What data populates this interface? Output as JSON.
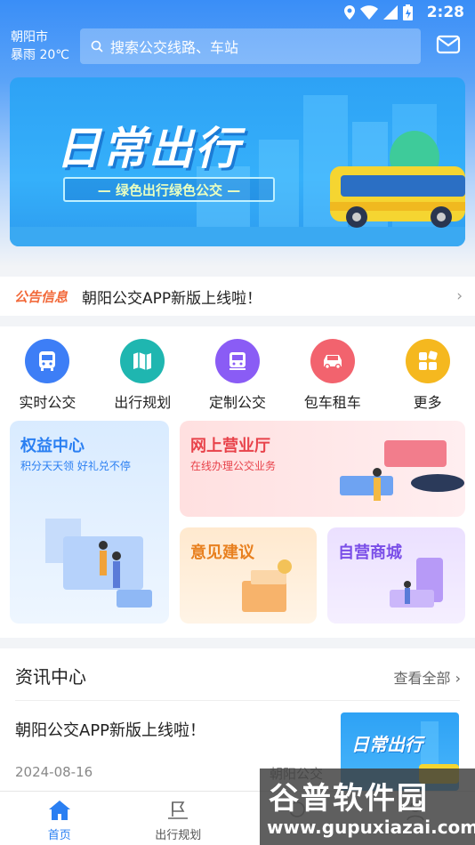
{
  "status_bar": {
    "time": "2:28"
  },
  "header": {
    "city": "朝阳市",
    "weather": "暴雨 20℃",
    "search_placeholder": "搜索公交线路、车站"
  },
  "banner": {
    "title": "日常出行",
    "subtitle": "— 绿色出行绿色公交 —"
  },
  "notice": {
    "tag": "公告信息",
    "text": "朝阳公交APP新版上线啦！"
  },
  "services": [
    {
      "label": "实时公交",
      "icon": "bus-icon",
      "color": "#3d7ef6"
    },
    {
      "label": "出行规划",
      "icon": "map-icon",
      "color": "#1fb6b0"
    },
    {
      "label": "定制公交",
      "icon": "custom-bus-icon",
      "color": "#8a5cf5"
    },
    {
      "label": "包车租车",
      "icon": "car-icon",
      "color": "#f2636e"
    },
    {
      "label": "更多",
      "icon": "more-grid-icon",
      "color": "#f5b81f"
    }
  ],
  "cards": {
    "rights": {
      "title": "权益中心",
      "subtitle": "积分天天领 好礼兑不停"
    },
    "hall": {
      "title": "网上营业厅",
      "subtitle": "在线办理公交业务"
    },
    "feedback": {
      "title": "意见建议"
    },
    "mall": {
      "title": "自营商城"
    }
  },
  "news": {
    "heading": "资讯中心",
    "more": "查看全部",
    "item": {
      "title": "朝阳公交APP新版上线啦！",
      "date": "2024-08-16",
      "source": "朝阳公交",
      "thumb_text": "日常出行"
    }
  },
  "tabbar": [
    {
      "label": "首页",
      "active": true
    },
    {
      "label": "出行规划",
      "active": false
    },
    {
      "label": "",
      "active": false
    },
    {
      "label": "",
      "active": false
    }
  ],
  "watermark": {
    "title": "谷普软件园",
    "url": "www.gupuxiazai.com"
  }
}
